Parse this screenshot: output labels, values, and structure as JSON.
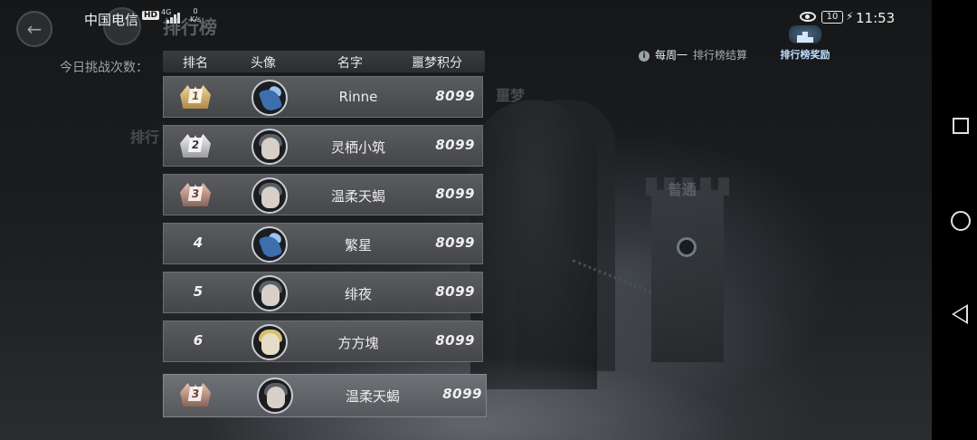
{
  "status_bar": {
    "carrier": "中国电信",
    "hd_badge": "HD",
    "network": "4G",
    "speed_value": "0",
    "speed_unit": "K/s",
    "battery": "10",
    "time": "11:53"
  },
  "header": {
    "title_partial": "排行榜",
    "challenge_label": "今日挑战次数："
  },
  "weekly_note": {
    "highlight": "每周一",
    "text": "排行榜结算"
  },
  "reward_button": {
    "label": "排行榜奖励"
  },
  "background_labels": {
    "nightmare": "噩梦",
    "normal": "普通",
    "rank_fragment": "排行"
  },
  "board": {
    "columns": [
      "排名",
      "头像",
      "名字",
      "噩梦积分"
    ],
    "rows": [
      {
        "rank": "1",
        "name": "Rinne",
        "score": "8099",
        "medal": "gold",
        "avatar": "dragon-avatar"
      },
      {
        "rank": "2",
        "name": "灵栖小筑",
        "score": "8099",
        "medal": "silver",
        "avatar": "boy-avatar"
      },
      {
        "rank": "3",
        "name": "温柔天蝎",
        "score": "8099",
        "medal": "bronze",
        "avatar": "boy-avatar"
      },
      {
        "rank": "4",
        "name": "繁星",
        "score": "8099",
        "medal": "",
        "avatar": "dragon-avatar"
      },
      {
        "rank": "5",
        "name": "绯夜",
        "score": "8099",
        "medal": "",
        "avatar": "boy-avatar"
      },
      {
        "rank": "6",
        "name": "方方塊",
        "score": "8099",
        "medal": "",
        "avatar": "blond-avatar"
      }
    ],
    "me": {
      "rank": "3",
      "name": "温柔天蝎",
      "score": "8099",
      "medal": "bronze",
      "avatar": "boy-avatar"
    }
  }
}
